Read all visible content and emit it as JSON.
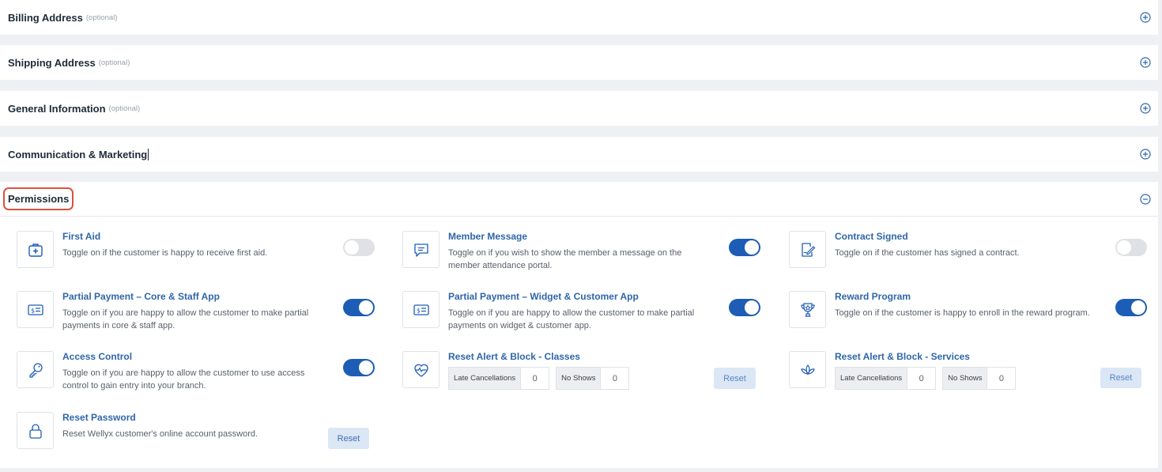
{
  "sections": [
    {
      "title": "Billing Address",
      "optional": "(optional)"
    },
    {
      "title": "Shipping Address",
      "optional": "(optional)"
    },
    {
      "title": "General Information",
      "optional": "(optional)"
    },
    {
      "title": "Communication & Marketing",
      "optional": ""
    }
  ],
  "permissions": {
    "title": "Permissions",
    "items": {
      "first_aid": {
        "title": "First Aid",
        "desc": "Toggle on if the customer is happy to receive first aid.",
        "enabled": false
      },
      "member_message": {
        "title": "Member Message",
        "desc": "Toggle on if you wish to show the member a message on the member attendance portal.",
        "enabled": true
      },
      "contract_signed": {
        "title": "Contract Signed",
        "desc": "Toggle on if the customer has signed a contract.",
        "enabled": false
      },
      "partial_core": {
        "title": "Partial Payment – Core & Staff App",
        "desc": "Toggle on if you are happy to allow the customer to make partial payments in core & staff app.",
        "enabled": true
      },
      "partial_widget": {
        "title": "Partial Payment – Widget & Customer App",
        "desc": "Toggle on if you are happy to allow the customer to make partial payments on widget & customer app.",
        "enabled": true
      },
      "reward_program": {
        "title": "Reward Program",
        "desc": "Toggle on if the customer is happy to enroll in the reward program.",
        "enabled": true
      },
      "access_control": {
        "title": "Access Control",
        "desc": "Toggle on if you are happy to allow the customer to use access control to gain entry into your branch.",
        "enabled": true
      },
      "reset_classes": {
        "title": "Reset Alert & Block - Classes",
        "late_label": "Late Cancellations",
        "late_value": "0",
        "noshow_label": "No Shows",
        "noshow_value": "0",
        "button": "Reset"
      },
      "reset_services": {
        "title": "Reset Alert & Block - Services",
        "late_label": "Late Cancellations",
        "late_value": "0",
        "noshow_label": "No Shows",
        "noshow_value": "0",
        "button": "Reset"
      },
      "reset_password": {
        "title": "Reset Password",
        "desc": "Reset Wellyx customer's online account password.",
        "button": "Reset"
      }
    }
  },
  "colors": {
    "accent": "#1d5db5",
    "link": "#2f66a8",
    "highlight": "#d9533f"
  }
}
